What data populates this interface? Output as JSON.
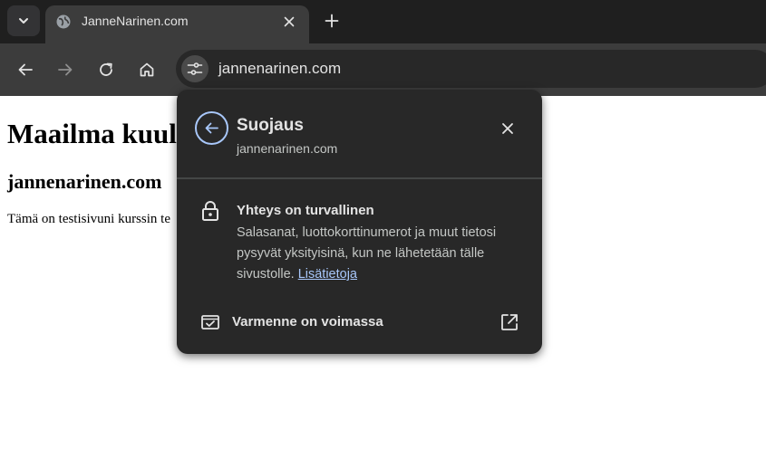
{
  "browser": {
    "tab": {
      "title": "JanneNarinen.com",
      "favicon": "globe-icon"
    },
    "toolbar": {
      "url": "jannenarinen.com",
      "icons": [
        "back-arrow-icon",
        "forward-arrow-icon",
        "reload-icon",
        "home-icon",
        "site-info-icon"
      ]
    }
  },
  "page": {
    "heading1": "Maailma kuul",
    "heading2": "jannenarinen.com",
    "paragraph": "Tämä on testisivuni kurssin te"
  },
  "security_popup": {
    "title": "Suojaus",
    "site": "jannenarinen.com",
    "connection_title": "Yhteys on turvallinen",
    "connection_desc": "Salasanat, luottokorttinumerot ja muut tietosi pysyvät yksityisinä, kun ne lähetetään tälle sivustolle. ",
    "learn_more": "Lisätietoja",
    "certificate_label": "Varmenne on voimassa"
  },
  "colors": {
    "tabstrip": "#1f1f1f",
    "toolbar": "#3c3c3c",
    "popup_bg": "#282828",
    "accent": "#a8c7fa",
    "text_primary": "#e3e3e3",
    "text_secondary": "#c4c7c5"
  }
}
